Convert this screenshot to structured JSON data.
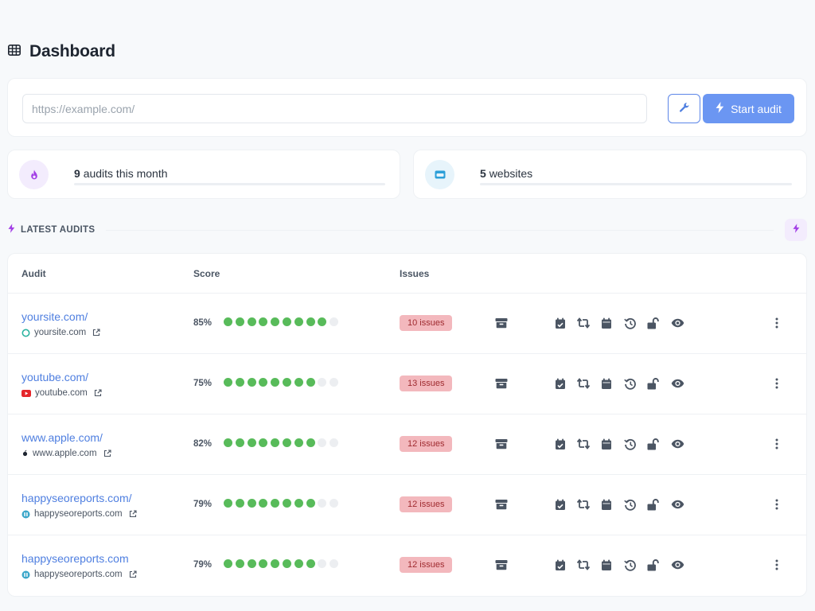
{
  "page": {
    "title": "Dashboard"
  },
  "audit_form": {
    "url_placeholder": "https://example.com/",
    "url_value": "",
    "start_label": "Start audit"
  },
  "stats": [
    {
      "value": "9",
      "label": "audits this month",
      "icon": "fire-icon"
    },
    {
      "value": "5",
      "label": "websites",
      "icon": "browser-window-icon"
    }
  ],
  "section": {
    "title": "LATEST AUDITS"
  },
  "table": {
    "headers": {
      "audit": "Audit",
      "score": "Score",
      "issues": "Issues"
    },
    "rows": [
      {
        "url": "yoursite.com/",
        "domain": "yoursite.com",
        "favicon": "ring-favicon",
        "score_label": "85%",
        "score": 85,
        "issues": "10 issues"
      },
      {
        "url": "youtube.com/",
        "domain": "youtube.com",
        "favicon": "youtube-favicon",
        "score_label": "75%",
        "score": 75,
        "issues": "13 issues"
      },
      {
        "url": "www.apple.com/",
        "domain": "www.apple.com",
        "favicon": "apple-favicon",
        "score_label": "82%",
        "score": 82,
        "issues": "12 issues"
      },
      {
        "url": "happyseoreports.com/",
        "domain": "happyseoreports.com",
        "favicon": "happyseo-favicon",
        "score_label": "79%",
        "score": 79,
        "issues": "12 issues"
      },
      {
        "url": "happyseoreports.com",
        "domain": "happyseoreports.com",
        "favicon": "happyseo-favicon",
        "score_label": "79%",
        "score": 79,
        "issues": "12 issues"
      }
    ]
  },
  "colors": {
    "primary": "#6b96f2",
    "link": "#4f7fe0",
    "score_dot": "#58bb5a",
    "score_dot_empty": "#eceef1",
    "issues_bg": "#f3b8bd",
    "issues_text": "#9f2a2f",
    "accent_purple": "#a33fe6"
  },
  "row_actions": [
    "archive-icon",
    "schedule-icon",
    "recheck-icon",
    "calendar-icon",
    "history-icon",
    "unlock-icon",
    "view-icon",
    "more-menu-icon"
  ]
}
